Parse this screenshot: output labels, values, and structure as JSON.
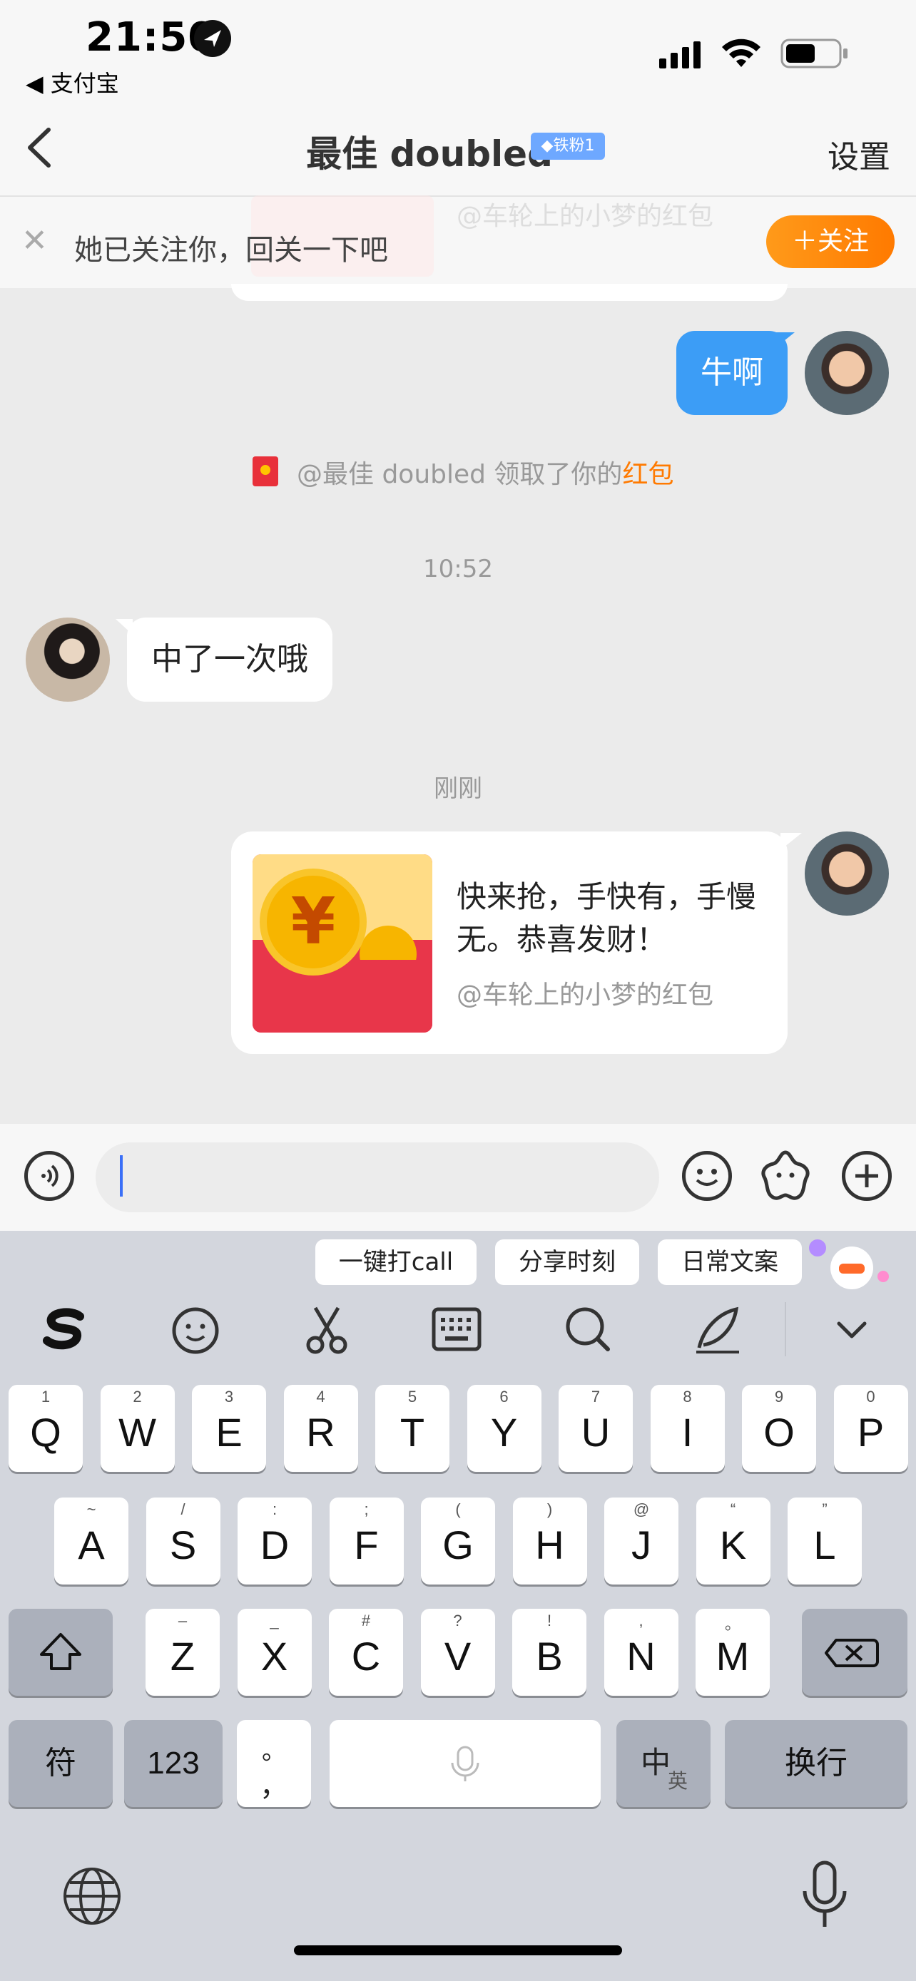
{
  "status": {
    "time": "21:50",
    "back_app": "◀ 支付宝"
  },
  "nav": {
    "title": "最佳 doubled",
    "fan_badge": "◆铁粉1",
    "settings": "设置"
  },
  "follow_bar": {
    "text": "她已关注你，回关一下吧",
    "button": "＋关注",
    "ghost_text": "@车轮上的小梦的红包"
  },
  "messages": {
    "me_1": "牛啊",
    "system": {
      "prefix": "@最佳 doubled 领取了你的",
      "highlight": "红包"
    },
    "time_1": "10:52",
    "her_1": "中了一次哦",
    "time_2": "刚刚",
    "red_packet": {
      "title": "快来抢，手快有，手慢无。恭喜发财！",
      "sub": "@车轮上的小梦的红包"
    }
  },
  "input": {
    "placeholder": ""
  },
  "keyboard": {
    "suggestions": [
      "一键打call",
      "分享时刻",
      "日常文案"
    ],
    "row1": [
      {
        "sup": "1",
        "key": "Q"
      },
      {
        "sup": "2",
        "key": "W"
      },
      {
        "sup": "3",
        "key": "E"
      },
      {
        "sup": "4",
        "key": "R"
      },
      {
        "sup": "5",
        "key": "T"
      },
      {
        "sup": "6",
        "key": "Y"
      },
      {
        "sup": "7",
        "key": "U"
      },
      {
        "sup": "8",
        "key": "I"
      },
      {
        "sup": "9",
        "key": "O"
      },
      {
        "sup": "0",
        "key": "P"
      }
    ],
    "row2": [
      {
        "sup": "~",
        "key": "A"
      },
      {
        "sup": "/",
        "key": "S"
      },
      {
        "sup": ":",
        "key": "D"
      },
      {
        "sup": ";",
        "key": "F"
      },
      {
        "sup": "(",
        "key": "G"
      },
      {
        "sup": ")",
        "key": "H"
      },
      {
        "sup": "@",
        "key": "J"
      },
      {
        "sup": "“",
        "key": "K"
      },
      {
        "sup": "”",
        "key": "L"
      }
    ],
    "row3": [
      {
        "sup": "–",
        "key": "Z"
      },
      {
        "sup": "_",
        "key": "X"
      },
      {
        "sup": "#",
        "key": "C"
      },
      {
        "sup": "?",
        "key": "V"
      },
      {
        "sup": "!",
        "key": "B"
      },
      {
        "sup": ",",
        "key": "N"
      },
      {
        "sup": "。",
        "key": "M"
      }
    ],
    "fu": "符",
    "num": "123",
    "punct_top": "。",
    "punct_bottom": "，",
    "lang_main": "中",
    "lang_sub": "英",
    "enter": "换行"
  },
  "colors": {
    "accent_blue": "#3c9df6",
    "follow_orange": "#ff8c00",
    "red_packet": "#e8364a",
    "highlight_orange": "#ff7a00"
  },
  "icons": {
    "voice": "voice-wave-icon",
    "emoji": "smiley-icon",
    "sticker": "sticker-star-icon",
    "plus": "plus-circle-icon"
  }
}
